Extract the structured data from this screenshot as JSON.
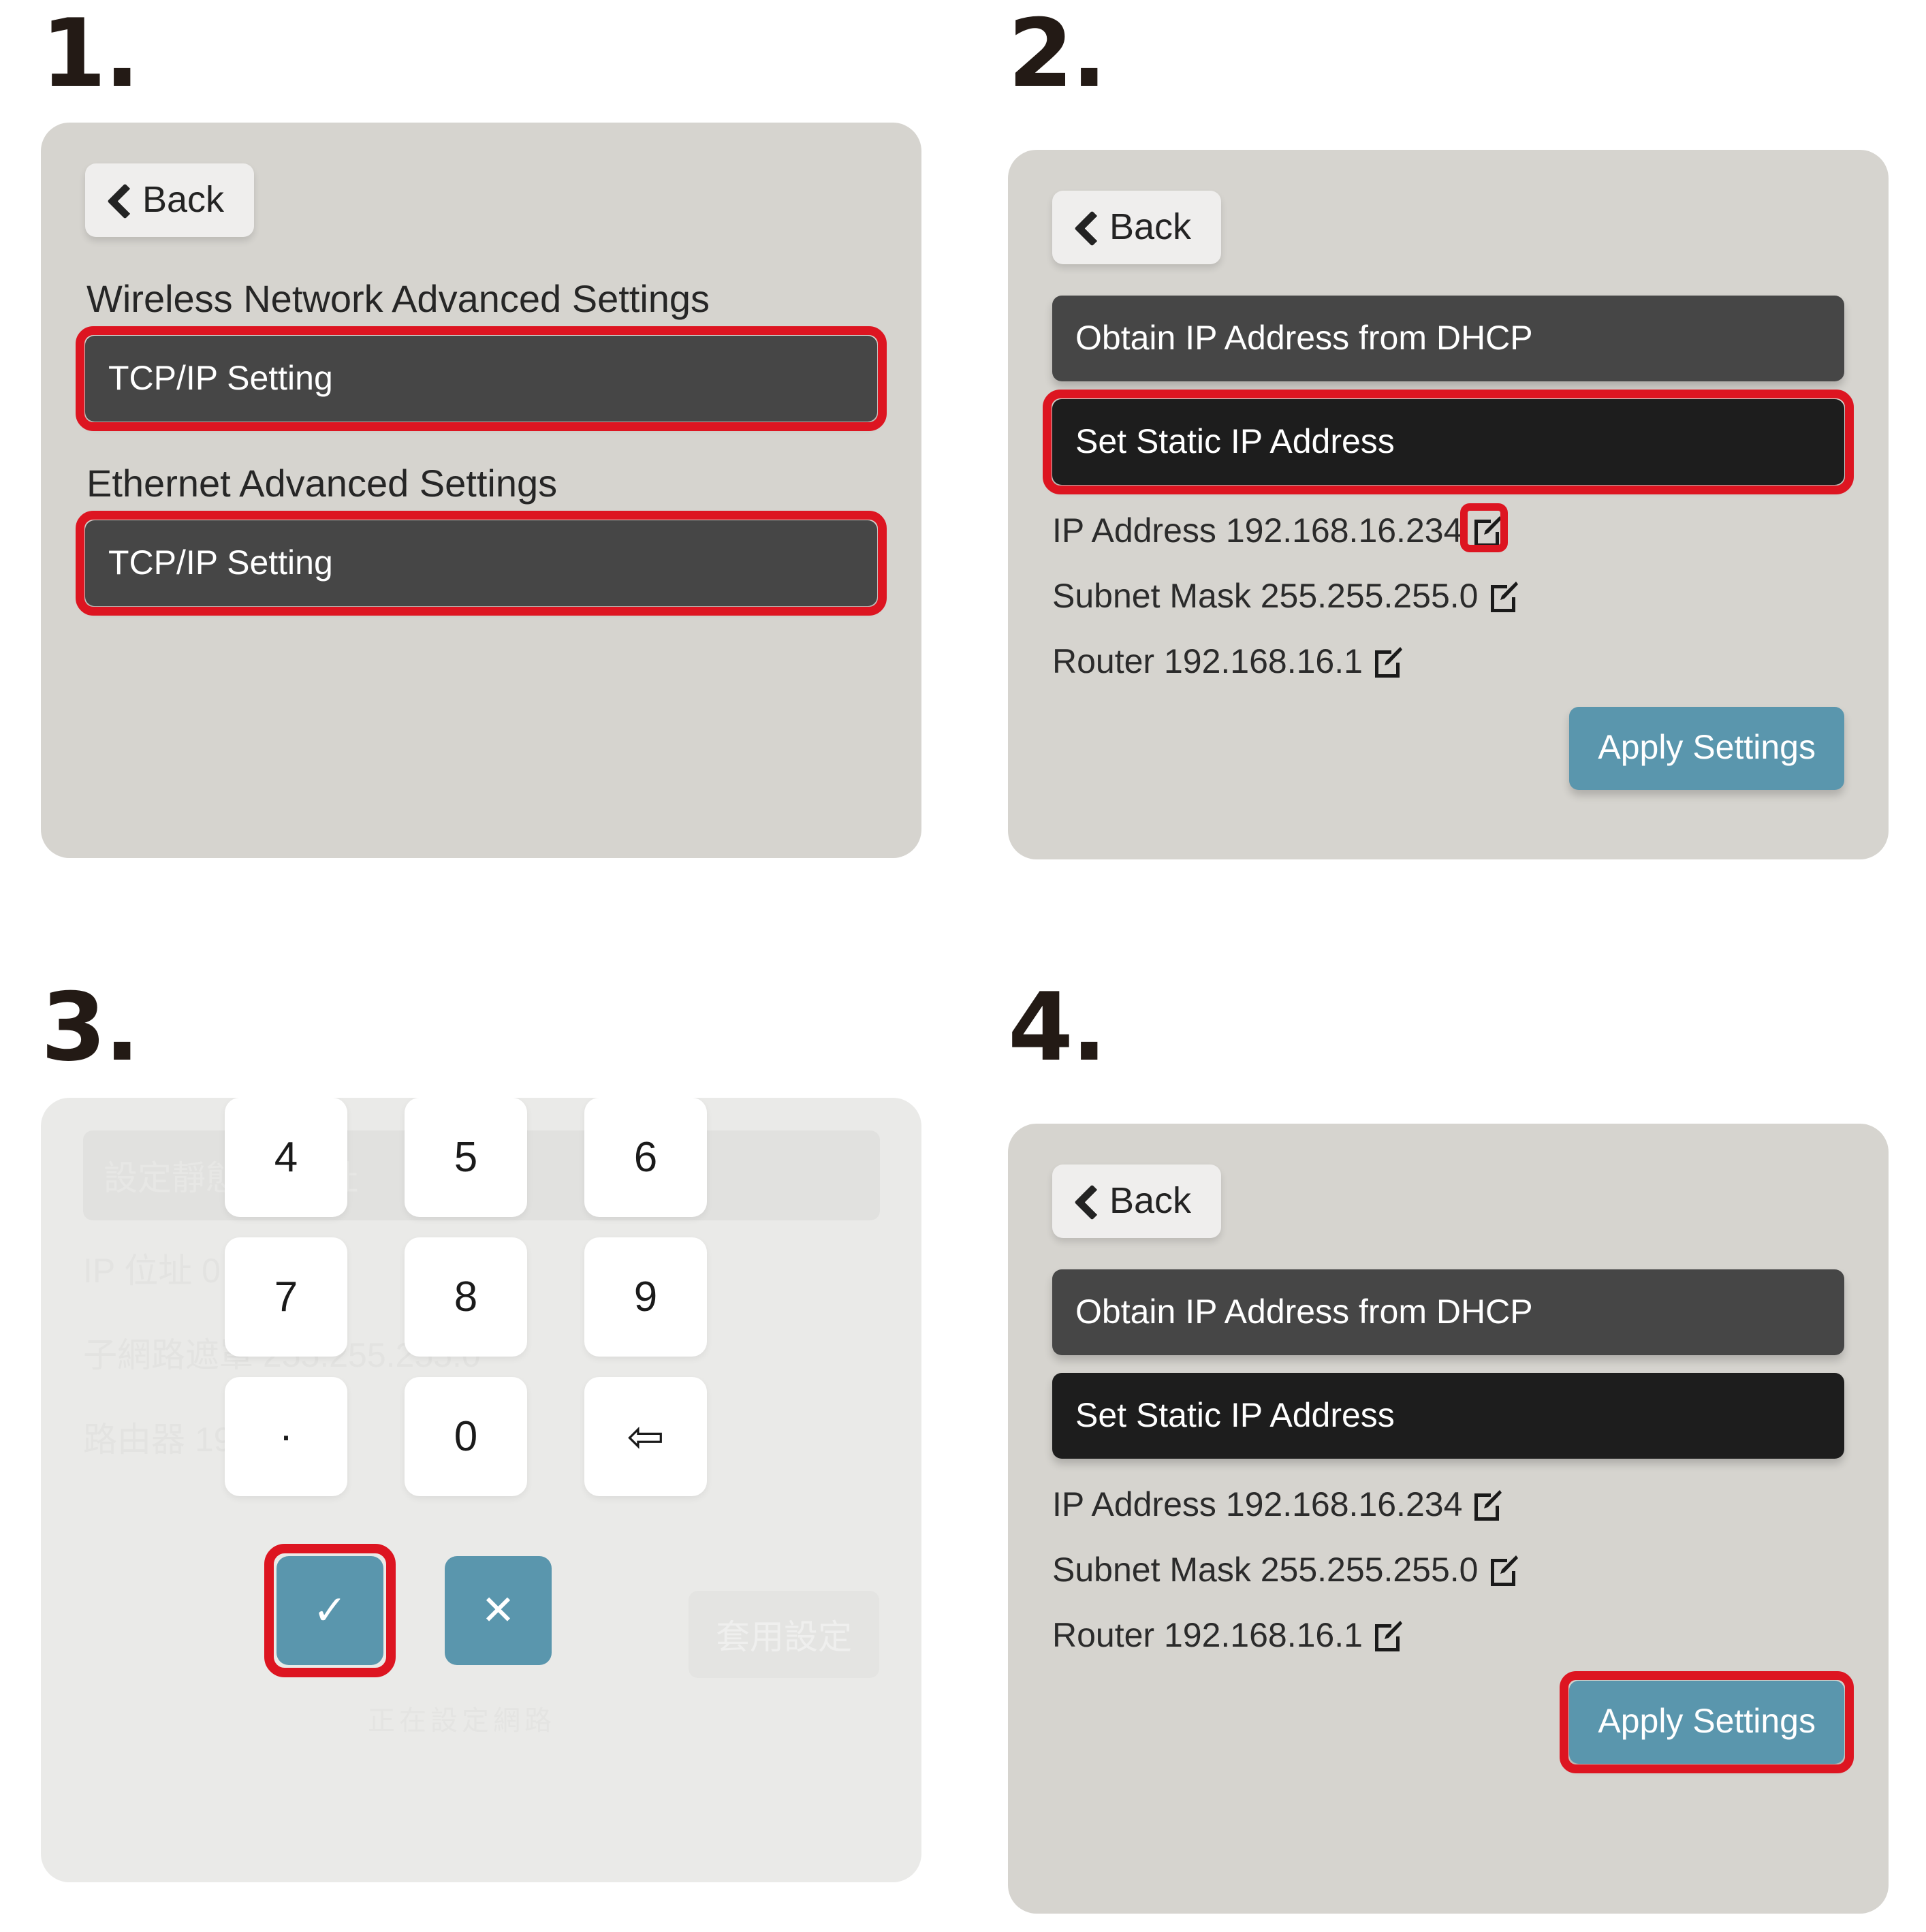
{
  "steps": [
    {
      "number": "1."
    },
    {
      "number": "2."
    },
    {
      "number": "3."
    },
    {
      "number": "4."
    }
  ],
  "colors": {
    "panel_bg": "#d6d4cf",
    "panel_bg_dim": "#eaeae8",
    "dark_button": "#464646",
    "dark_button_selected": "#1d1d1d",
    "highlight_red": "#dd1521",
    "accent_teal": "#5a96ad",
    "step_number": "#231a15",
    "back_button_bg": "#efeeed"
  },
  "panel1": {
    "back_label": "Back",
    "back_icon": "chevron-left-icon",
    "section_wireless": "Wireless Network Advanced Settings",
    "section_ethernet": "Ethernet Advanced Settings",
    "tcpip_label": "TCP/IP Setting"
  },
  "panel2": {
    "back_label": "Back",
    "back_icon": "chevron-left-icon",
    "dhcp_label": "Obtain IP Address from DHCP",
    "static_label": "Set Static IP Address",
    "rows": [
      {
        "label": "IP Address",
        "value": "192.168.16.234",
        "icon": "edit-pencil-icon",
        "highlighted": true
      },
      {
        "label": "Subnet Mask",
        "value": "255.255.255.0",
        "icon": "edit-pencil-icon",
        "highlighted": false
      },
      {
        "label": "Router",
        "value": "192.168.16.1",
        "icon": "edit-pencil-icon",
        "highlighted": false
      }
    ],
    "apply_label": "Apply Settings"
  },
  "panel3": {
    "ghost": {
      "button_top": "設定靜態 IP 位址",
      "row_ip": "IP 位址 0",
      "row_subnet": "子網路遮罩 255.255.255.0",
      "row_router": "路由器 19        0.1",
      "apply_label": "套用設定",
      "cancel_label": "正在設定網路"
    },
    "keys": [
      "4",
      "5",
      "6",
      "7",
      "8",
      "9",
      ".",
      "0",
      "⇦"
    ],
    "key_icons": [
      "key-4",
      "key-5",
      "key-6",
      "key-7",
      "key-8",
      "key-9",
      "key-dot",
      "key-0",
      "backspace-icon"
    ],
    "confirm_glyph": "✓",
    "cancel_glyph": "✕"
  },
  "panel4": {
    "back_label": "Back",
    "back_icon": "chevron-left-icon",
    "dhcp_label": "Obtain IP Address from DHCP",
    "static_label": "Set Static IP Address",
    "rows": [
      {
        "label": "IP Address",
        "value": "192.168.16.234",
        "icon": "edit-pencil-icon"
      },
      {
        "label": "Subnet Mask",
        "value": "255.255.255.0",
        "icon": "edit-pencil-icon"
      },
      {
        "label": "Router",
        "value": "192.168.16.1",
        "icon": "edit-pencil-icon"
      }
    ],
    "apply_label": "Apply Settings"
  }
}
